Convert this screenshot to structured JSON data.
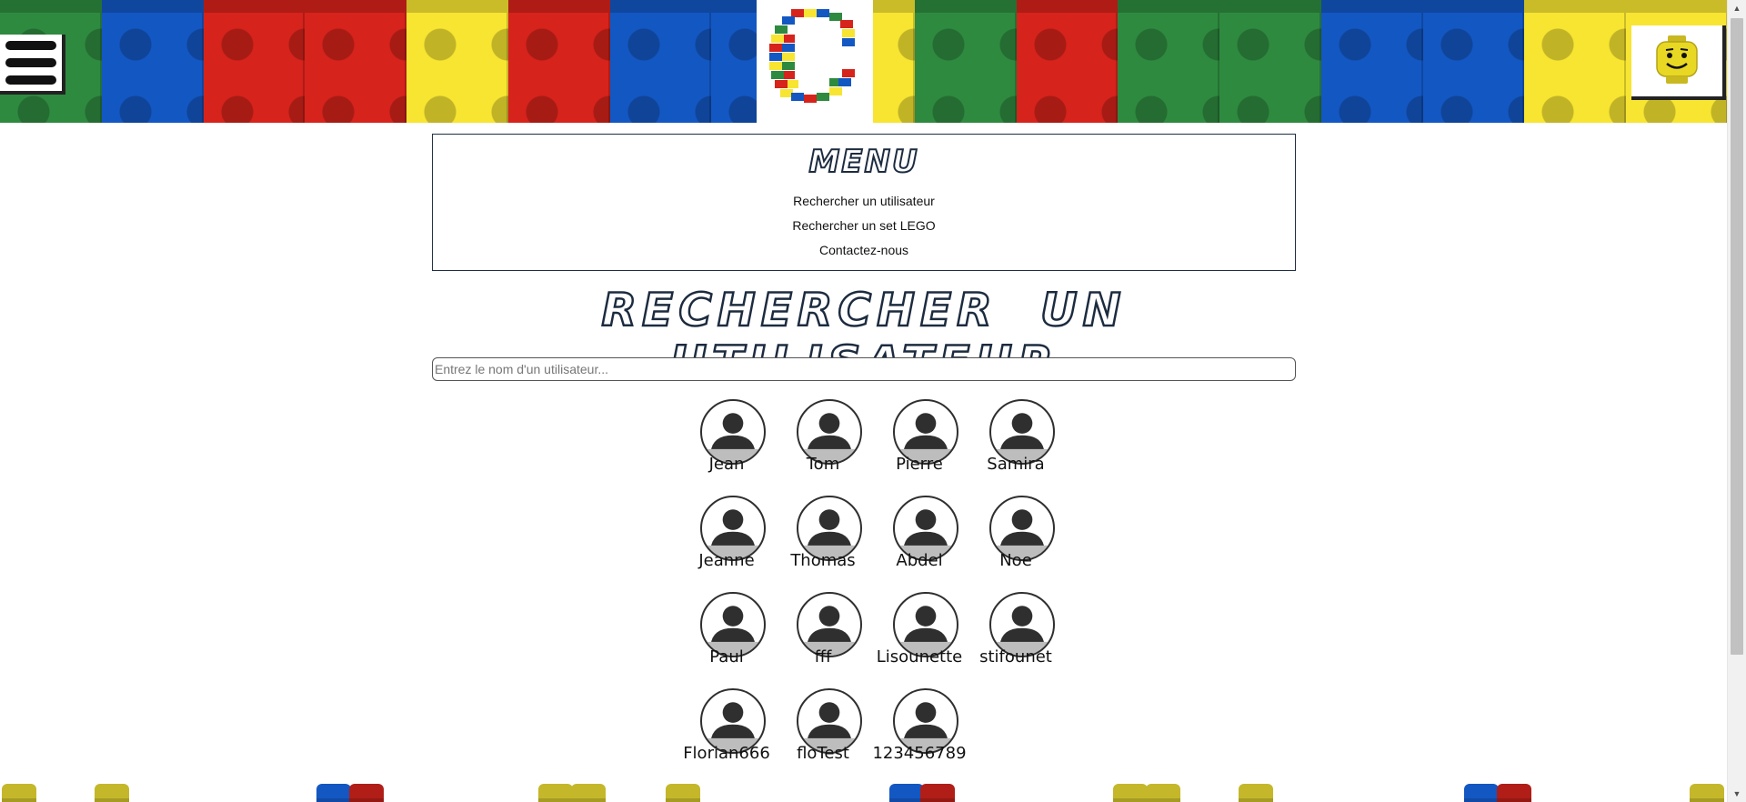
{
  "header": {
    "menu_icon": "hamburger-icon",
    "logo_icon": "lego-c-logo",
    "profile_icon": "lego-minifig-head-icon",
    "brick_colors": [
      "#2e8a3f",
      "#1357c3",
      "#d6231b",
      "#d6231b",
      "#f7e531",
      "#d6231b",
      "#1357c3",
      "#1357c3",
      "#f7e531",
      "#2e8a3f",
      "#d6231b",
      "#2e8a3f",
      "#2e8a3f",
      "#1357c3",
      "#1357c3",
      "#f7e531",
      "#f7e531"
    ]
  },
  "menu": {
    "title": "MENU",
    "items": [
      {
        "label": "Rechercher un utilisateur"
      },
      {
        "label": "Rechercher un set LEGO"
      },
      {
        "label": "Contactez-nous"
      }
    ]
  },
  "page": {
    "title": "RECHERCHER UN UTILISATEUR",
    "search_placeholder": "Entrez le nom d'un utilisateur..."
  },
  "users": [
    {
      "name": "Jean"
    },
    {
      "name": "Tom"
    },
    {
      "name": "Pierre"
    },
    {
      "name": "Samira"
    },
    {
      "name": "Jeanne"
    },
    {
      "name": "Thomas"
    },
    {
      "name": "Abdel"
    },
    {
      "name": "Noe"
    },
    {
      "name": "Paul"
    },
    {
      "name": "fff"
    },
    {
      "name": "Lisounette"
    },
    {
      "name": "stifounet"
    },
    {
      "name": "Florian666"
    },
    {
      "name": "floTest"
    },
    {
      "name": "123456789"
    }
  ],
  "colors": {
    "red": "#d6231b",
    "blue": "#1357c3",
    "green": "#2e8a3f",
    "yellow": "#f7e531",
    "title_outline": "#1c2b3f",
    "avatar": "#2f2f2f"
  }
}
